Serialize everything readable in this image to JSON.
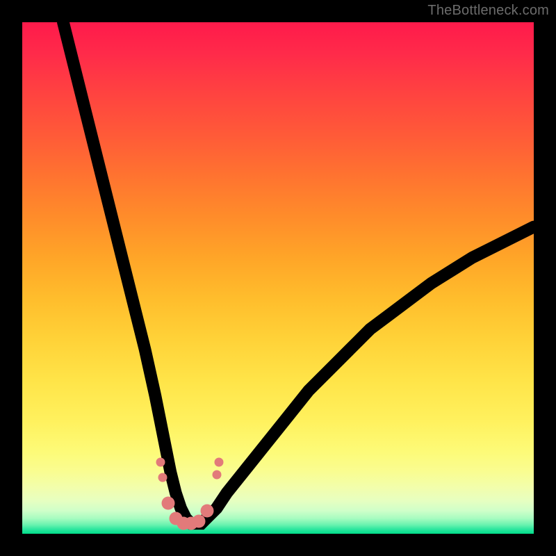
{
  "watermark": "TheBottleneck.com",
  "chart_data": {
    "type": "line",
    "title": "",
    "xlabel": "",
    "ylabel": "",
    "xlim": [
      0,
      100
    ],
    "ylim": [
      0,
      100
    ],
    "grid": false,
    "legend": false,
    "background_gradient": {
      "direction": "vertical",
      "stops": [
        {
          "pos": 0.0,
          "color": "#ff1a4b"
        },
        {
          "pos": 0.5,
          "color": "#ffbd2c"
        },
        {
          "pos": 0.85,
          "color": "#fdfb78"
        },
        {
          "pos": 1.0,
          "color": "#00dd8a"
        }
      ]
    },
    "series": [
      {
        "name": "bottleneck-curve",
        "color": "#000000",
        "x": [
          8,
          10,
          12,
          14,
          16,
          18,
          20,
          22,
          24,
          26,
          27,
          28,
          29,
          30,
          31,
          32,
          33,
          34,
          35,
          36,
          38,
          40,
          44,
          48,
          52,
          56,
          60,
          64,
          68,
          72,
          76,
          80,
          84,
          88,
          92,
          96,
          100
        ],
        "y": [
          100,
          92,
          84,
          76,
          68,
          60,
          52,
          44,
          36,
          27,
          22,
          17,
          12,
          8,
          5,
          3,
          2,
          2,
          2,
          3,
          5,
          8,
          13,
          18,
          23,
          28,
          32,
          36,
          40,
          43,
          46,
          49,
          51.5,
          54,
          56,
          58,
          60
        ]
      }
    ],
    "markers": {
      "color": "#e27a7a",
      "points_small": [
        {
          "x": 27.0,
          "y": 14.0
        },
        {
          "x": 27.5,
          "y": 11.0
        },
        {
          "x": 38.0,
          "y": 11.5
        },
        {
          "x": 38.5,
          "y": 14.0
        }
      ],
      "points_big": [
        {
          "x": 28.5,
          "y": 6.0
        },
        {
          "x": 30.0,
          "y": 3.0
        },
        {
          "x": 31.5,
          "y": 2.0
        },
        {
          "x": 33.0,
          "y": 2.0
        },
        {
          "x": 34.5,
          "y": 2.5
        },
        {
          "x": 36.2,
          "y": 4.5
        }
      ]
    }
  }
}
